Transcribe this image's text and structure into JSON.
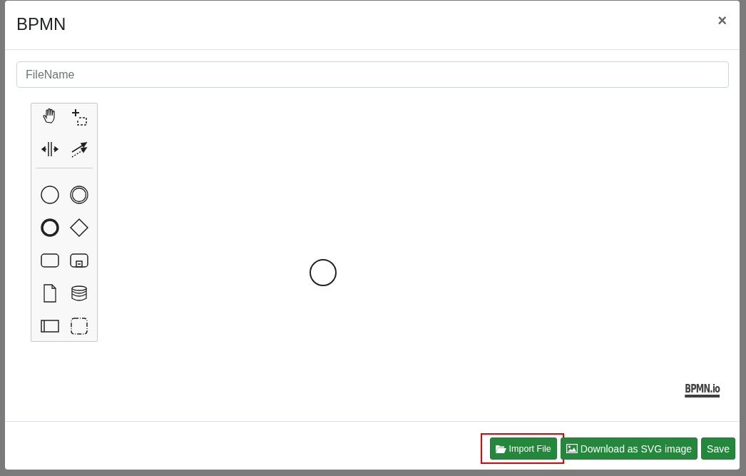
{
  "dialog": {
    "title": "BPMN",
    "close": "×"
  },
  "filename": {
    "placeholder": "FileName"
  },
  "canvas": {
    "logo": "BPMN.io"
  },
  "buttons": [
    {
      "label": "Import File",
      "kind": "folder",
      "highlighted": true
    },
    {
      "label": "Download as SVG image",
      "kind": "image",
      "highlighted": false
    },
    {
      "label": "Save",
      "kind": "plain",
      "highlighted": false
    }
  ]
}
